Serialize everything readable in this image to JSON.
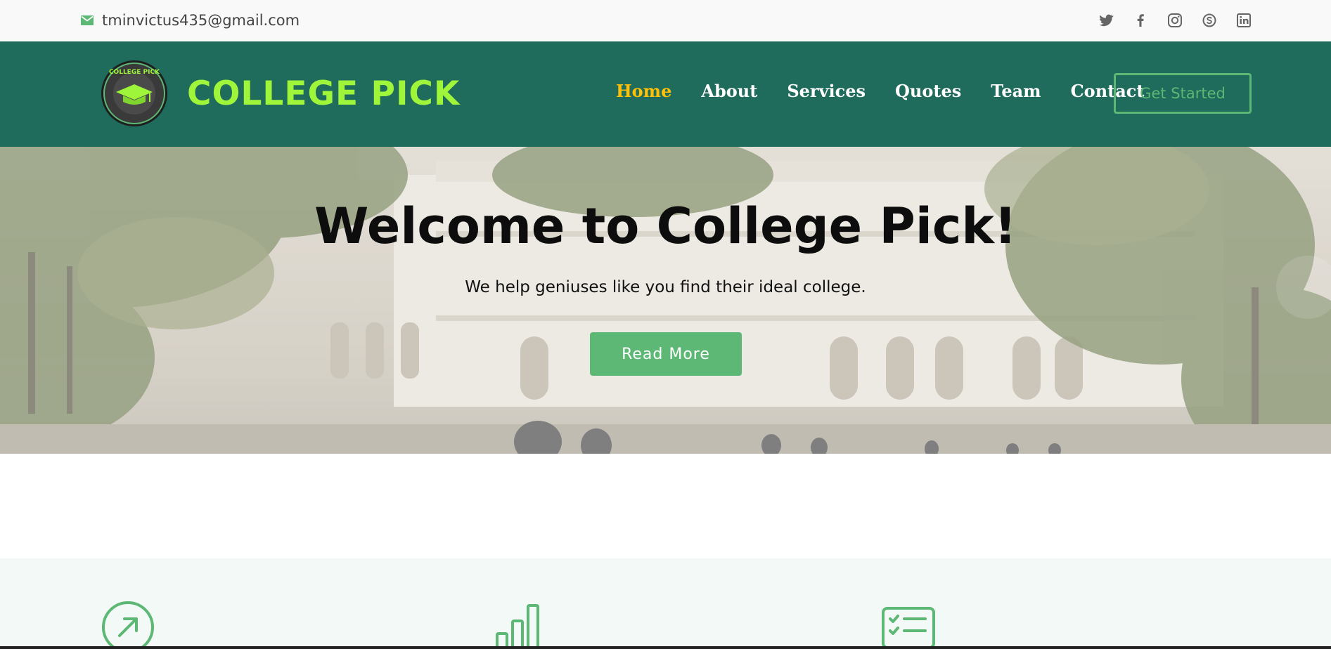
{
  "topbar": {
    "email_icon": "envelope-icon",
    "email": "tminvictus435@gmail.com",
    "social": [
      {
        "name": "twitter-icon"
      },
      {
        "name": "facebook-icon"
      },
      {
        "name": "instagram-icon"
      },
      {
        "name": "skype-icon"
      },
      {
        "name": "linkedin-icon"
      }
    ]
  },
  "header": {
    "logo_text": "COLLEGE PICK",
    "brand": "COLLEGE PICK",
    "nav": [
      "Home",
      "About",
      "Services",
      "Quotes",
      "Team",
      "Contact"
    ],
    "active_nav": "Home",
    "cta": "Get Started"
  },
  "hero": {
    "title": "Welcome to College Pick!",
    "subtitle": "We help geniuses like you find their ideal college.",
    "button": "Read More"
  },
  "features": {
    "icons": [
      "arrow-up-right-circle-icon",
      "bar-chart-icon",
      "checklist-icon"
    ]
  },
  "colors": {
    "header_bg": "#1f6b5c",
    "brand": "#9ef53a",
    "accent_green": "#5cb874",
    "active_nav": "#ffc107",
    "topbar_bg": "#f9f9f9",
    "features_bg": "#f3f9f6"
  }
}
